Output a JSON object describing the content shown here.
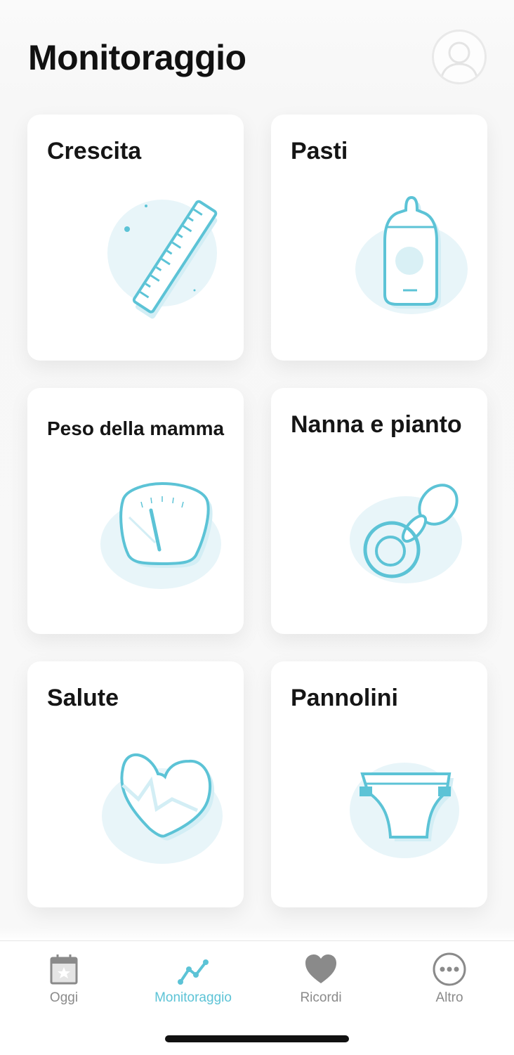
{
  "header": {
    "title": "Monitoraggio",
    "avatar_icon": "person-icon"
  },
  "cards": [
    {
      "title": "Crescita",
      "icon": "ruler-icon"
    },
    {
      "title": "Pasti",
      "icon": "baby-bottle-icon"
    },
    {
      "title": "Peso della mamma",
      "icon": "scale-icon"
    },
    {
      "title": "Nanna e pianto",
      "icon": "pacifier-icon"
    },
    {
      "title": "Salute",
      "icon": "heart-icon"
    },
    {
      "title": "Pannolini",
      "icon": "diaper-icon"
    }
  ],
  "tabbar": {
    "tabs": [
      {
        "label": "Oggi",
        "icon": "calendar-star-icon"
      },
      {
        "label": "Monitoraggio",
        "icon": "trend-line-icon",
        "active": true
      },
      {
        "label": "Ricordi",
        "icon": "heart-icon"
      },
      {
        "label": "Altro",
        "icon": "more-dots-icon"
      }
    ]
  },
  "colors": {
    "accent": "#5cc3d6",
    "illustration_bg": "#e8f5f9",
    "inactive": "#8a8a8a"
  }
}
